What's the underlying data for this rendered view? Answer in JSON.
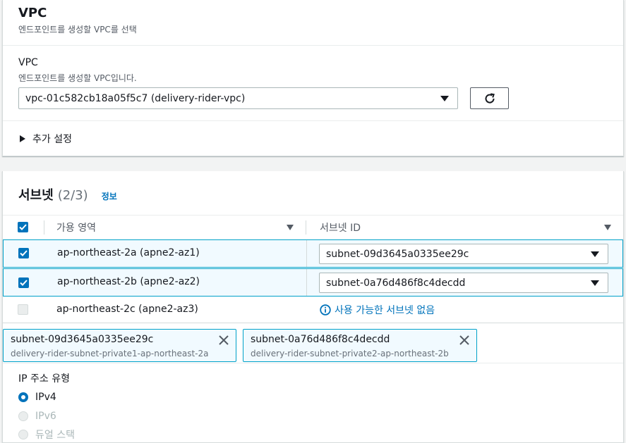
{
  "vpc_section": {
    "title": "VPC",
    "description": "엔드포인트를 생성할 VPC를 선택",
    "field_label": "VPC",
    "field_description": "엔드포인트를 생성할 VPC입니다.",
    "selected_vpc": "vpc-01c582cb18a05f5c7 (delivery-rider-vpc)",
    "additional_settings": "추가 설정"
  },
  "subnet_section": {
    "title": "서브넷",
    "count": "(2/3)",
    "info_link": "정보",
    "columns": [
      "가용 영역",
      "서브넷 ID"
    ],
    "rows": [
      {
        "az": "ap-northeast-2a (apne2-az1)",
        "subnet": "subnet-09d3645a0335ee29c",
        "selected": true
      },
      {
        "az": "ap-northeast-2b (apne2-az2)",
        "subnet": "subnet-0a76d486f8c4decdd",
        "selected": true
      },
      {
        "az": "ap-northeast-2c (apne2-az3)",
        "subnet": "사용 가능한 서브넷 없음",
        "selected": false
      }
    ],
    "tokens": [
      {
        "id": "subnet-09d3645a0335ee29c",
        "name": "delivery-rider-subnet-private1-ap-northeast-2a"
      },
      {
        "id": "subnet-0a76d486f8c4decdd",
        "name": "delivery-rider-subnet-private2-ap-northeast-2b"
      }
    ],
    "ip_type_label": "IP 주소 유형",
    "ip_options": [
      "IPv4",
      "IPv6",
      "듀얼 스택"
    ],
    "ip_selected": "IPv4"
  },
  "colors": {
    "accent": "#0073bb",
    "selected_row_bg": "#f1faff",
    "selected_border": "#00a1c9"
  }
}
